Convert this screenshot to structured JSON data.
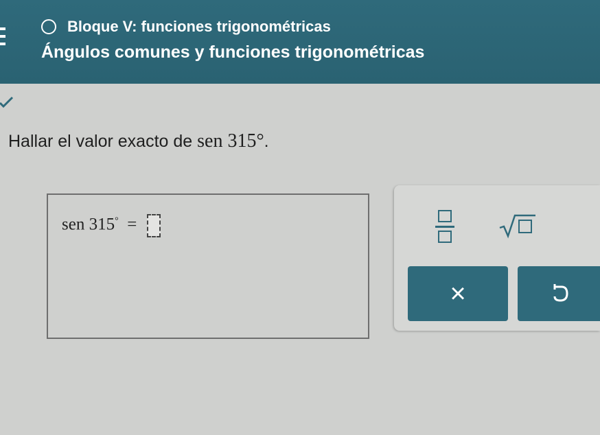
{
  "header": {
    "block_title": "Bloque V: funciones trigonométricas",
    "section_title": "Ángulos comunes y funciones trigonométricas",
    "bg_color": "#2f6a7b"
  },
  "question": {
    "prompt_text": "Hallar el valor exacto de ",
    "prompt_math": "sen 315°",
    "prompt_end": "."
  },
  "answer": {
    "lhs_func": "sen",
    "lhs_num": "315",
    "lhs_deg": "°",
    "equals": "="
  },
  "palette": {
    "clear_label": "×",
    "undo_icon": "undo-icon",
    "fraction_icon": "fraction-icon",
    "sqrt_icon": "sqrt-icon"
  }
}
